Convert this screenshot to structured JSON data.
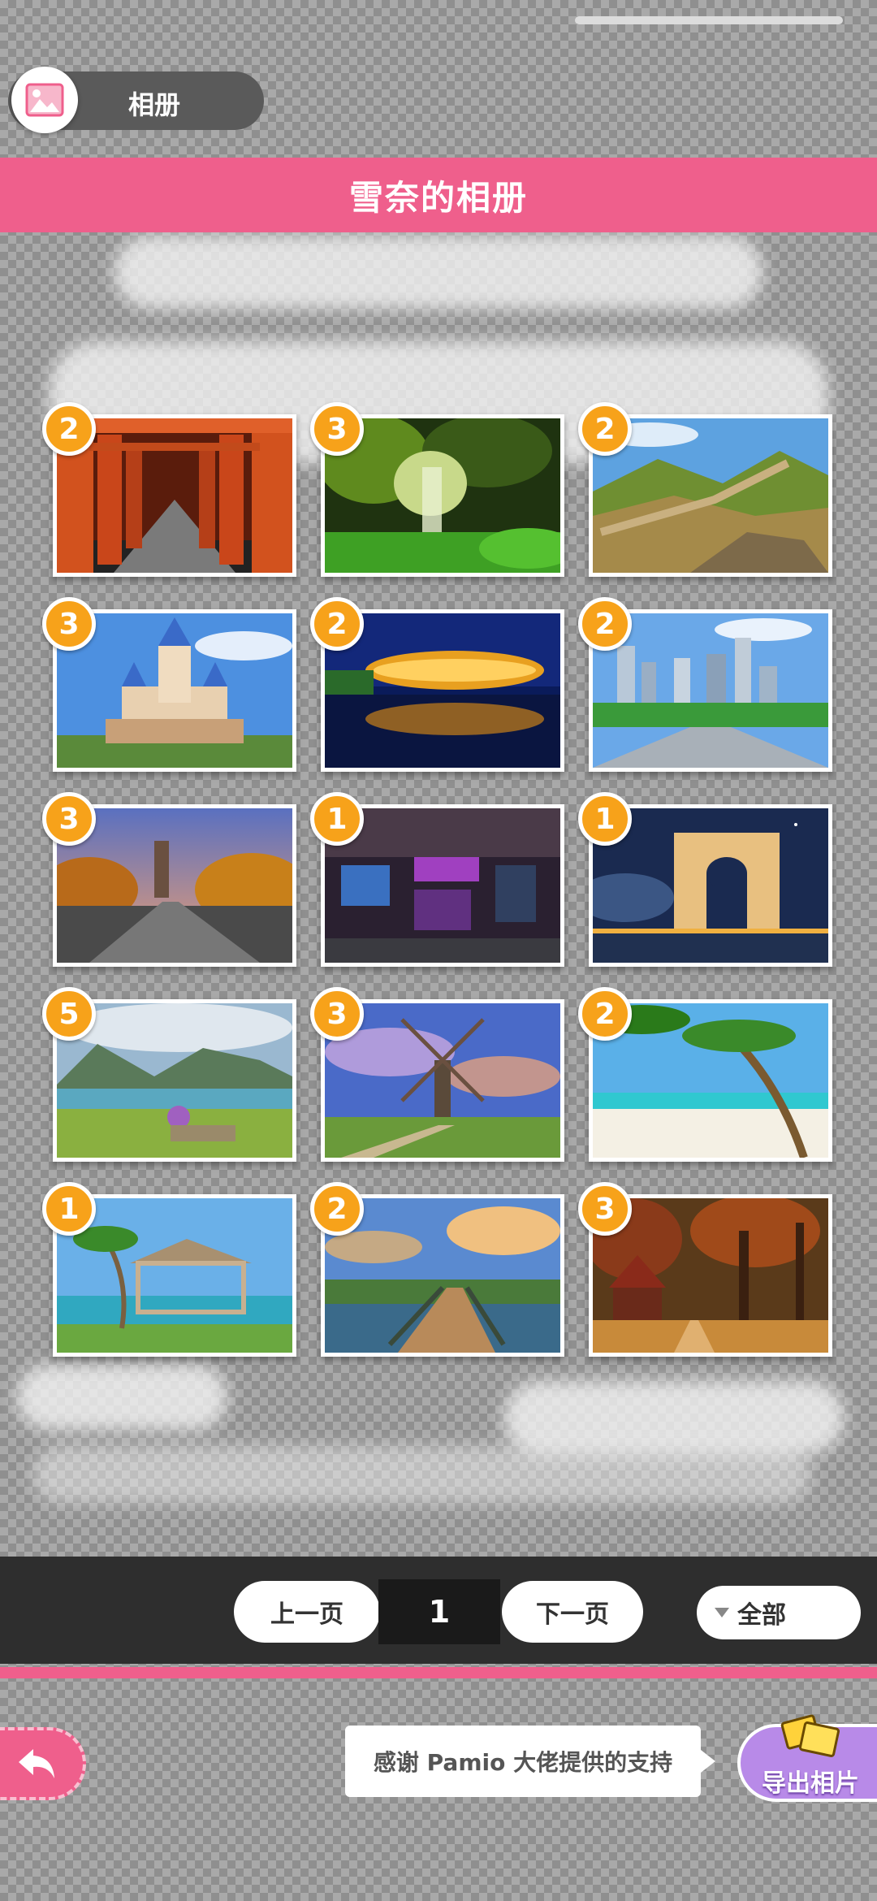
{
  "header": {
    "title": "相册",
    "icon": "photo-album-icon"
  },
  "banner": {
    "title": "雪奈的相册"
  },
  "photos": [
    {
      "count": "2",
      "scene": "torii-gates"
    },
    {
      "count": "3",
      "scene": "waterfall-forest"
    },
    {
      "count": "2",
      "scene": "great-wall"
    },
    {
      "count": "3",
      "scene": "castle"
    },
    {
      "count": "2",
      "scene": "birds-nest-stadium"
    },
    {
      "count": "2",
      "scene": "city-skyline"
    },
    {
      "count": "3",
      "scene": "railway-bridge-sunset"
    },
    {
      "count": "1",
      "scene": "night-street-bar"
    },
    {
      "count": "1",
      "scene": "triumphal-arch"
    },
    {
      "count": "5",
      "scene": "mountain-lake"
    },
    {
      "count": "3",
      "scene": "windmill"
    },
    {
      "count": "2",
      "scene": "tropical-beach"
    },
    {
      "count": "1",
      "scene": "beach-gazebo"
    },
    {
      "count": "2",
      "scene": "boardwalk-bridge"
    },
    {
      "count": "3",
      "scene": "forest-chapel"
    }
  ],
  "pager": {
    "prev_label": "上一页",
    "page": "1",
    "next_label": "下一页",
    "filter_label": "全部"
  },
  "footer": {
    "tip_text": "感谢 Pamio 大佬提供的支持",
    "export_label": "导出相片",
    "back_icon": "back-arrow-icon",
    "export_icon": "photo-cards-icon"
  },
  "colors": {
    "accent_pink": "#ef5f8c",
    "badge_orange": "#f7a21a",
    "export_purple": "#b88ae8"
  }
}
